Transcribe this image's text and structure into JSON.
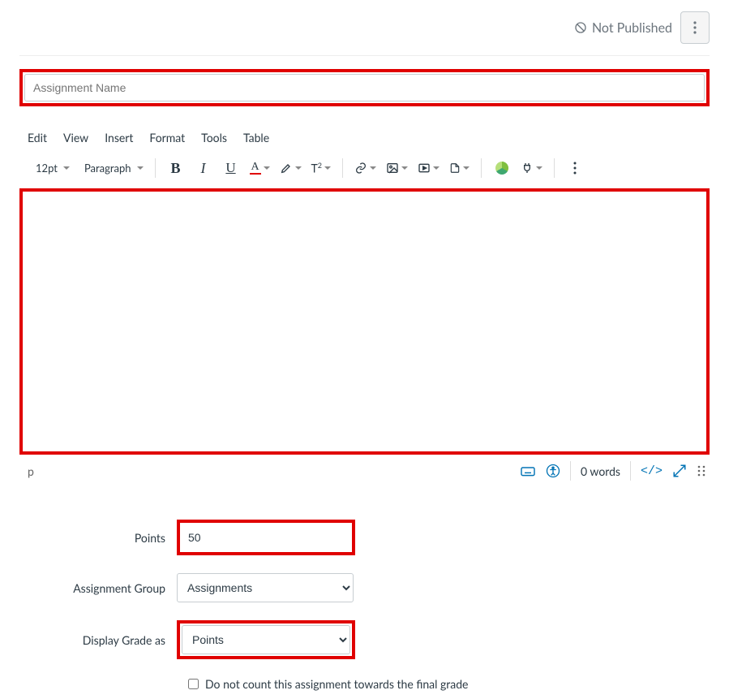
{
  "header": {
    "publish_status": "Not Published"
  },
  "name_field": {
    "placeholder": "Assignment Name",
    "value": ""
  },
  "editor": {
    "menubar": [
      "Edit",
      "View",
      "Insert",
      "Format",
      "Tools",
      "Table"
    ],
    "font_size": "12pt",
    "block_format": "Paragraph",
    "content": "",
    "path": "p",
    "word_count": "0 words",
    "html_toggle": "</>"
  },
  "form": {
    "points_label": "Points",
    "points_value": "50",
    "assignment_group_label": "Assignment Group",
    "assignment_group_value": "Assignments",
    "display_grade_label": "Display Grade as",
    "display_grade_value": "Points",
    "no_count_label": "Do not count this assignment towards the final grade"
  }
}
